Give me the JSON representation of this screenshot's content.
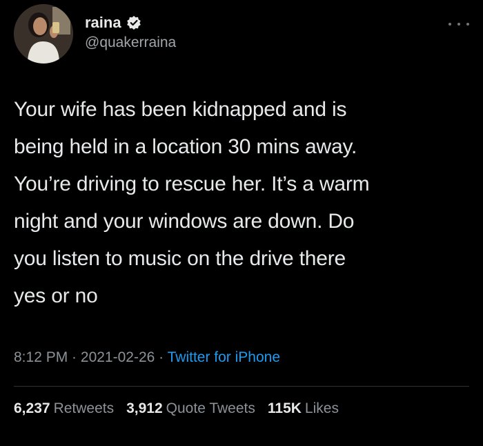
{
  "author": {
    "display_name": "raina",
    "handle": "@quakerraina",
    "verified": true
  },
  "tweet": {
    "text": "Your wife has been kidnapped and is\nbeing held in a location 30 mins away.\nYou’re driving to rescue her. It’s a warm\nnight and your windows are down. Do\nyou listen to music on the drive there\nyes or no",
    "time": "8:12 PM",
    "date": "2021-02-26",
    "separator": " · ",
    "source": "Twitter for iPhone"
  },
  "stats": {
    "retweets_count": "6,237",
    "retweets_label": "Retweets",
    "quotes_count": "3,912",
    "quotes_label": "Quote Tweets",
    "likes_count": "115K",
    "likes_label": "Likes"
  },
  "icons": {
    "verified": "verified-badge-icon",
    "more": "more-options-icon"
  },
  "colors": {
    "background": "#000000",
    "text": "#e7e9ea",
    "muted": "#8b9298",
    "link": "#1d9bf0"
  }
}
